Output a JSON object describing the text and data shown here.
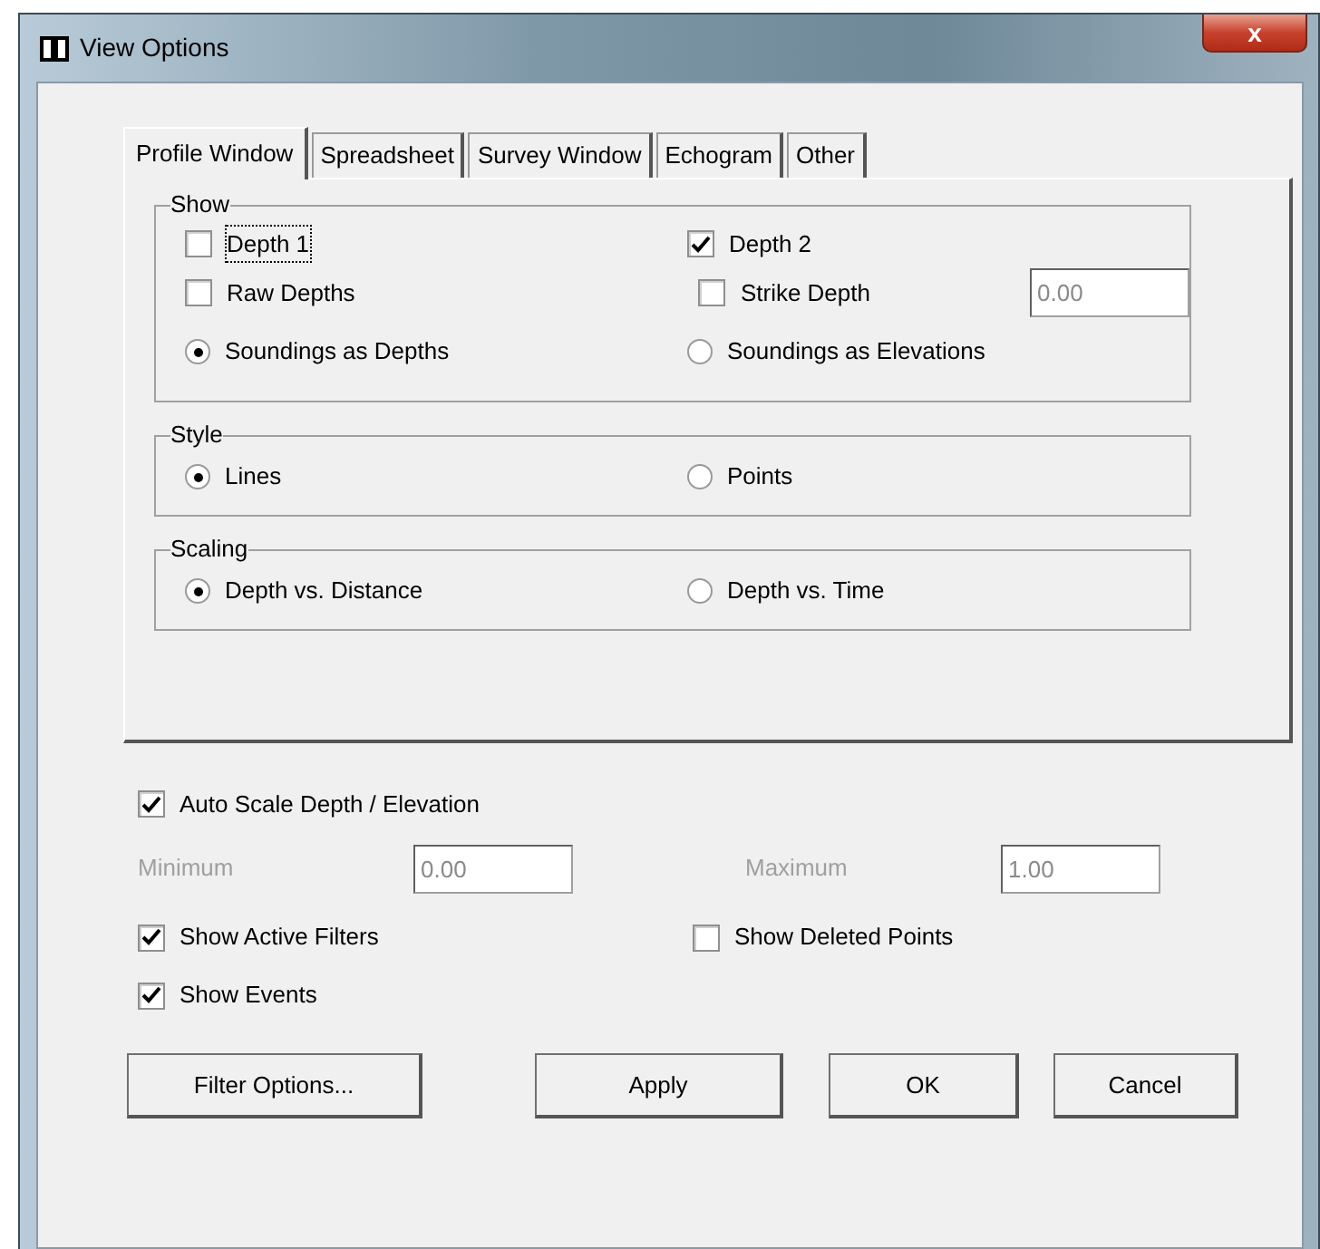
{
  "window": {
    "title": "View Options",
    "close_label": "x"
  },
  "tabs": [
    {
      "label": "Profile Window",
      "selected": true
    },
    {
      "label": "Spreadsheet",
      "selected": false
    },
    {
      "label": "Survey Window",
      "selected": false
    },
    {
      "label": "Echogram",
      "selected": false
    },
    {
      "label": "Other",
      "selected": false
    }
  ],
  "groups": [
    {
      "title": "Show",
      "rows": [
        [
          {
            "kind": "checkbox",
            "label": "Depth 1",
            "checked": false,
            "focused": true
          },
          {
            "kind": "checkbox",
            "label": "Depth 2",
            "checked": true,
            "focused": false
          }
        ],
        [
          {
            "kind": "checkbox",
            "label": "Raw Depths",
            "checked": false,
            "focused": false
          },
          {
            "kind": "checkbox",
            "label": "Strike Depth",
            "checked": false,
            "focused": false
          },
          {
            "kind": "field",
            "value": "0.00",
            "disabled": true
          }
        ],
        [
          {
            "kind": "radio",
            "label": "Soundings as Depths",
            "selected": true
          },
          {
            "kind": "radio",
            "label": "Soundings as Elevations",
            "selected": false
          }
        ]
      ]
    },
    {
      "title": "Style",
      "rows": [
        [
          {
            "kind": "radio",
            "label": "Lines",
            "selected": true
          },
          {
            "kind": "radio",
            "label": "Points",
            "selected": false
          }
        ]
      ]
    },
    {
      "title": "Scaling",
      "rows": [
        [
          {
            "kind": "radio",
            "label": "Depth vs. Distance",
            "selected": true
          },
          {
            "kind": "radio",
            "label": "Depth vs. Time",
            "selected": false
          }
        ]
      ]
    }
  ],
  "auto_scale": {
    "label": "Auto Scale Depth / Elevation",
    "checked": true
  },
  "range": [
    {
      "label": "Minimum",
      "value": "0.00",
      "disabled": true
    },
    {
      "label": "Maximum",
      "value": "1.00",
      "disabled": true
    }
  ],
  "options": [
    [
      {
        "label": "Show Active Filters",
        "checked": true
      },
      {
        "label": "Show Deleted Points",
        "checked": false
      }
    ],
    [
      {
        "label": "Show Events",
        "checked": true
      }
    ]
  ],
  "buttons": [
    {
      "label": "Filter Options..."
    },
    {
      "label": "Apply"
    },
    {
      "label": "OK"
    },
    {
      "label": "Cancel"
    }
  ]
}
